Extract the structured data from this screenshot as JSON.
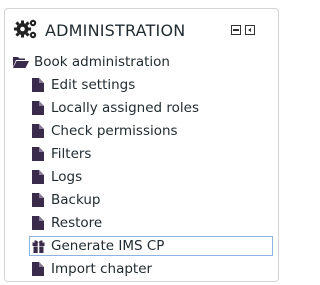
{
  "block": {
    "title": "ADMINISTRATION",
    "header_icon": "gears-icon",
    "controls": [
      {
        "name": "hide-block-icon"
      },
      {
        "name": "dock-block-icon"
      }
    ]
  },
  "tree": {
    "parent": {
      "label": "Book administration",
      "icon": "folder-open-icon"
    },
    "items": [
      {
        "label": "Edit settings",
        "icon": "file-icon"
      },
      {
        "label": "Locally assigned roles",
        "icon": "file-icon"
      },
      {
        "label": "Check permissions",
        "icon": "file-icon"
      },
      {
        "label": "Filters",
        "icon": "file-icon"
      },
      {
        "label": "Logs",
        "icon": "file-icon"
      },
      {
        "label": "Backup",
        "icon": "file-icon"
      },
      {
        "label": "Restore",
        "icon": "file-icon"
      },
      {
        "label": "Generate IMS CP",
        "icon": "gift-icon",
        "focused": true
      },
      {
        "label": "Import chapter",
        "icon": "file-icon"
      }
    ]
  },
  "colors": {
    "text": "#1f2a30",
    "icon": "#3a2b4a",
    "border": "#d4d4d4",
    "focus_border": "#8fb3e0"
  }
}
